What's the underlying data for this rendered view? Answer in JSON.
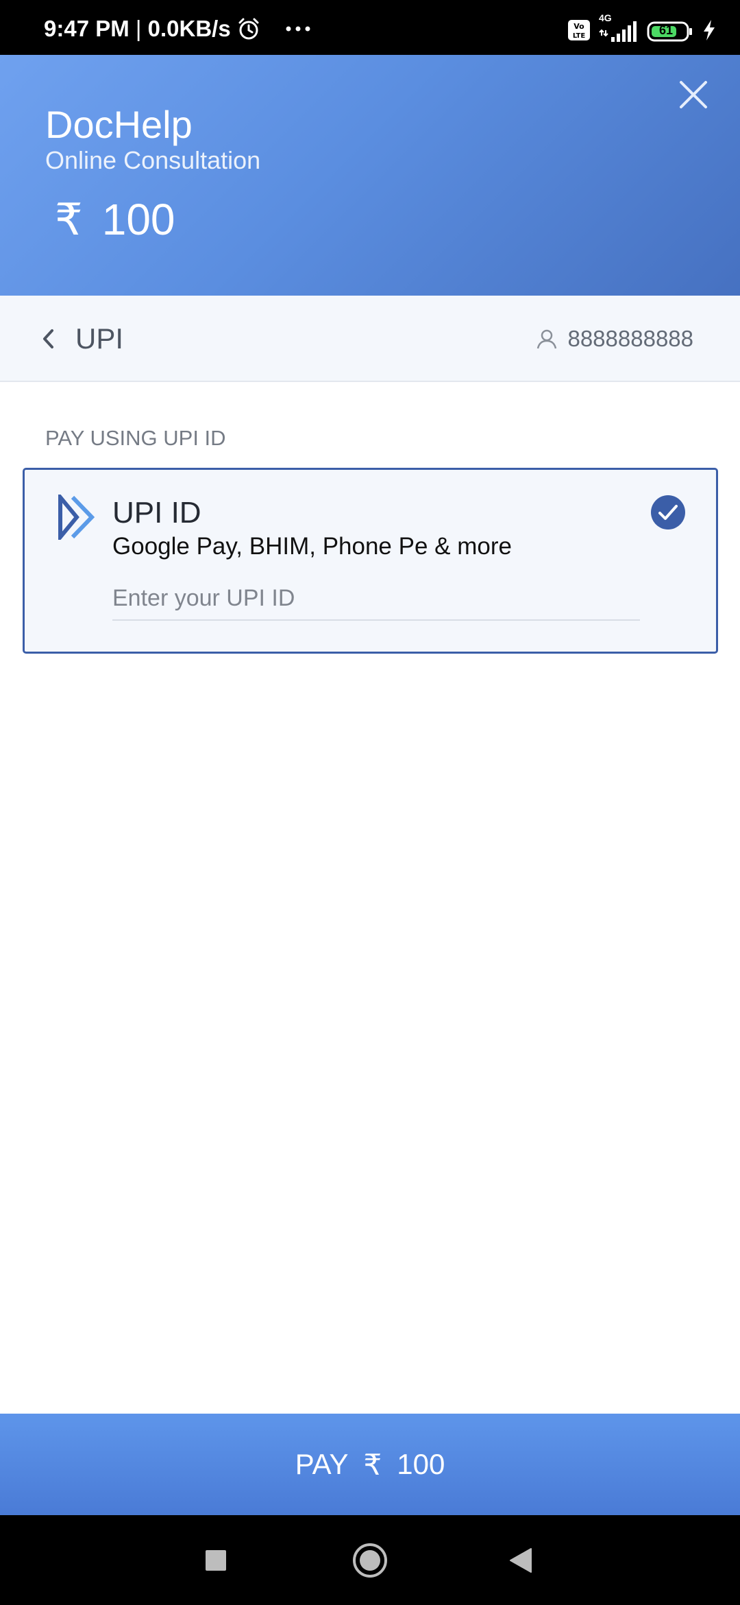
{
  "status_bar": {
    "time": "9:47 PM",
    "separator": " | ",
    "net_speed": "0.0KB/s",
    "volte_label": "Vo LTE",
    "network_type": "4G",
    "battery_level": "61"
  },
  "header": {
    "merchant_name": "DocHelp",
    "merchant_subtitle": "Online Consultation",
    "currency_symbol": "₹",
    "amount": "100"
  },
  "method_bar": {
    "title": "UPI",
    "contact_number": "8888888888"
  },
  "content": {
    "section_label": "PAY USING UPI ID",
    "upi_option": {
      "title": "UPI ID",
      "apps": "Google Pay, BHIM, Phone Pe & more",
      "input_value": "",
      "input_placeholder": "Enter your UPI ID",
      "selected": true
    }
  },
  "pay_button": {
    "label": "PAY",
    "currency_symbol": "₹",
    "amount": "100"
  },
  "colors": {
    "header_gradient_start": "#6fa1ef",
    "header_gradient_end": "#4671c1",
    "card_border": "#3b5ea8",
    "card_background": "#f4f7fc",
    "check_fill": "#3b5ea8",
    "pay_button": "#5a8fe6"
  },
  "icons": {
    "close": "close-icon",
    "back": "chevron-left-icon",
    "contact": "user-icon",
    "upi_logo": "upi-logo-icon",
    "selected": "check-circle-icon"
  }
}
